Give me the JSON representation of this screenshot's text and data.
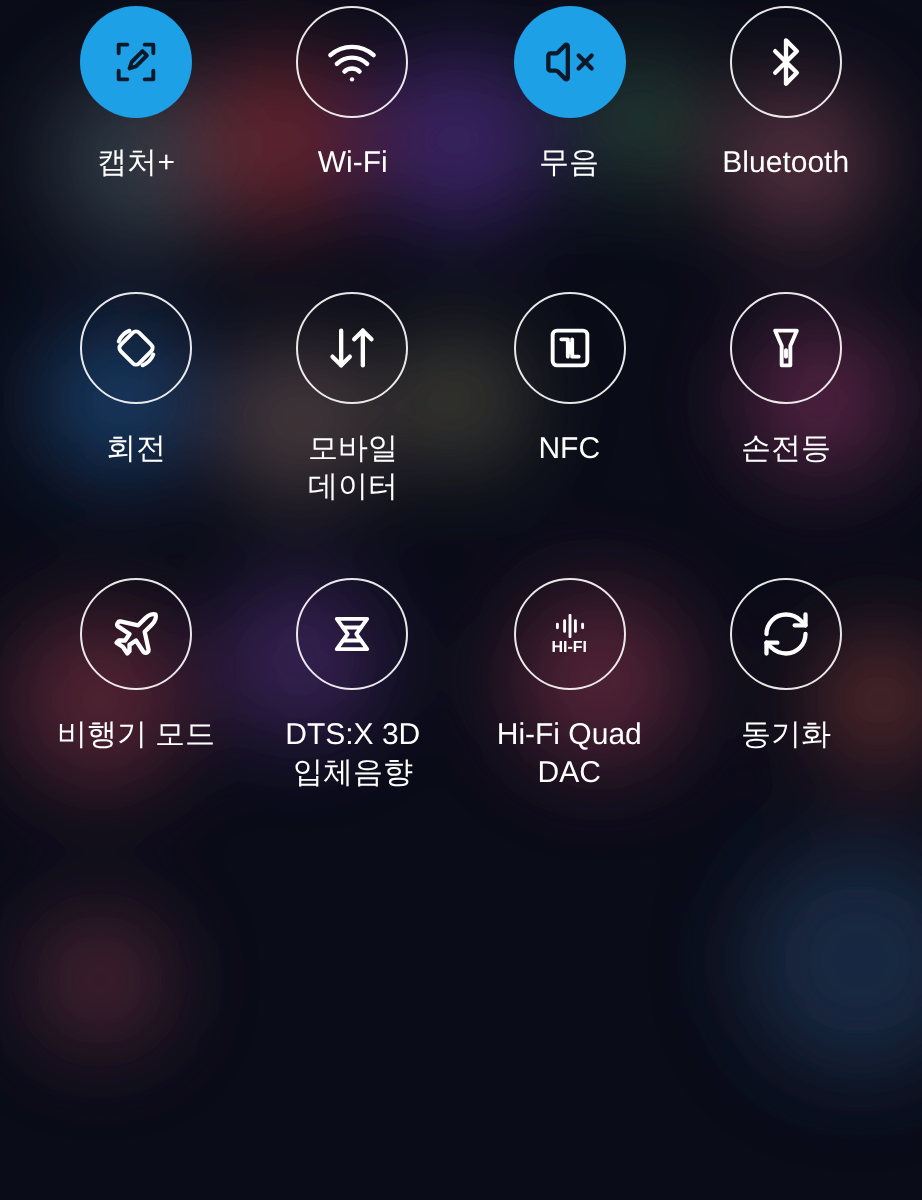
{
  "tiles": [
    {
      "label": "캡처+",
      "on": true
    },
    {
      "label": "Wi-Fi",
      "on": false
    },
    {
      "label": "무음",
      "on": true
    },
    {
      "label": "Bluetooth",
      "on": false
    },
    {
      "label": "회전",
      "on": false
    },
    {
      "label": "모바일\n데이터",
      "on": false
    },
    {
      "label": "NFC",
      "on": false
    },
    {
      "label": "손전등",
      "on": false
    },
    {
      "label": "비행기 모드",
      "on": false
    },
    {
      "label": "DTS:X 3D\n입체음향",
      "on": false
    },
    {
      "label": "Hi-Fi Quad\nDAC",
      "on": false,
      "icon_text": "HI-FI"
    },
    {
      "label": "동기화",
      "on": false
    }
  ]
}
